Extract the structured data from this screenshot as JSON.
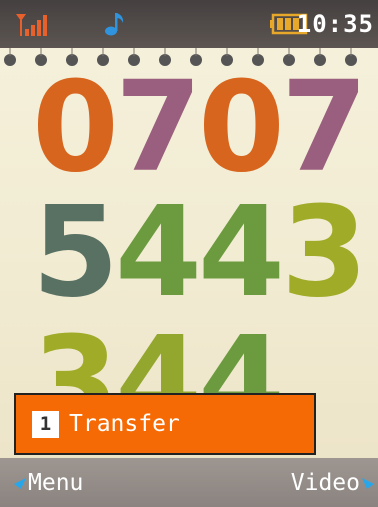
{
  "status": {
    "time": "10:35",
    "signal_icon": "signal-icon",
    "music_icon": "music-note-icon",
    "battery_icon": "battery-icon"
  },
  "wallpaper": {
    "row1": [
      "0",
      "7",
      "0",
      "7"
    ],
    "row2": [
      "5",
      "4",
      "4",
      "3"
    ],
    "row3": [
      "3",
      "4",
      "4"
    ],
    "colors": {
      "orange": "#d7651e",
      "purple": "#9a5f7e",
      "slate": "#597163",
      "green": "#6b9b3e",
      "olive": "#a0ab28",
      "lime": "#93a72e"
    }
  },
  "popup": {
    "number": "1",
    "label": "Transfer",
    "color": "#f56a04"
  },
  "softkeys": {
    "left": "Menu",
    "right": "Video",
    "arrow_color": "#28a6ea"
  }
}
